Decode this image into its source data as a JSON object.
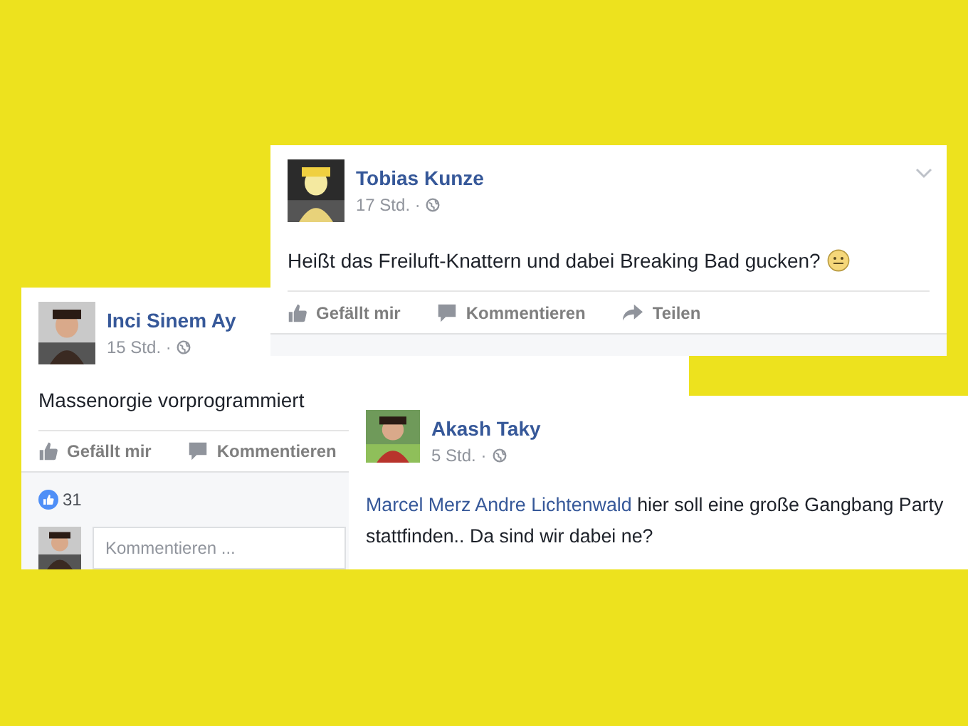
{
  "posts": [
    {
      "author": "Tobias Kunze",
      "time": "17 Std. ·",
      "text": "Heißt das Freiluft-Knattern und dabei Breaking Bad gucken?",
      "emoji": true,
      "menu": true,
      "actions": [
        {
          "kind": "like",
          "label": "Gefällt mir"
        },
        {
          "kind": "comment",
          "label": "Kommentieren"
        },
        {
          "kind": "share",
          "label": "Teilen"
        }
      ]
    },
    {
      "author": "Inci Sinem Ay",
      "time": "15 Std. ·",
      "text": "Massenorgie vorprogrammiert",
      "actions": [
        {
          "kind": "like",
          "label": "Gefällt mir"
        },
        {
          "kind": "comment",
          "label": "Kommentieren"
        }
      ],
      "like_count": "31",
      "comment_placeholder": "Kommentieren ..."
    },
    {
      "author": "Akash Taky",
      "time": "5 Std. ·",
      "mentions": [
        "Marcel Merz",
        "Andre Lichtenwald"
      ],
      "text": "hier soll eine große Gangbang Party stattfinden.. Da sind wir dabei ne?"
    }
  ]
}
